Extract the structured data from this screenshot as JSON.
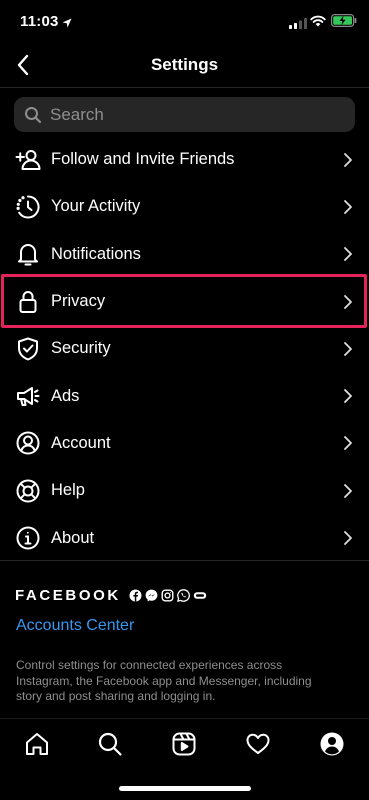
{
  "status_bar": {
    "time": "11:03"
  },
  "nav": {
    "title": "Settings"
  },
  "search": {
    "placeholder": "Search"
  },
  "menu": [
    {
      "label": "Follow and Invite Friends",
      "icon": "add-person-icon"
    },
    {
      "label": "Your Activity",
      "icon": "activity-clock-icon"
    },
    {
      "label": "Notifications",
      "icon": "bell-icon"
    },
    {
      "label": "Privacy",
      "icon": "lock-icon",
      "highlighted": true
    },
    {
      "label": "Security",
      "icon": "shield-icon"
    },
    {
      "label": "Ads",
      "icon": "megaphone-icon"
    },
    {
      "label": "Account",
      "icon": "person-circle-icon"
    },
    {
      "label": "Help",
      "icon": "lifebuoy-icon"
    },
    {
      "label": "About",
      "icon": "info-icon"
    }
  ],
  "facebook": {
    "wordmark": "FACEBOOK",
    "accounts_center": "Accounts Center",
    "description": "Control settings for connected experiences across Instagram, the Facebook app and Messenger, including story and post sharing and logging in."
  },
  "tab_bar": [
    "home-icon",
    "search-icon",
    "reels-icon",
    "heart-icon",
    "profile-icon"
  ],
  "colors": {
    "background": "#000000",
    "link": "#3797f0",
    "highlight": "#e3245a",
    "search_bg": "#262626",
    "secondary_text": "#8e8e8e"
  }
}
